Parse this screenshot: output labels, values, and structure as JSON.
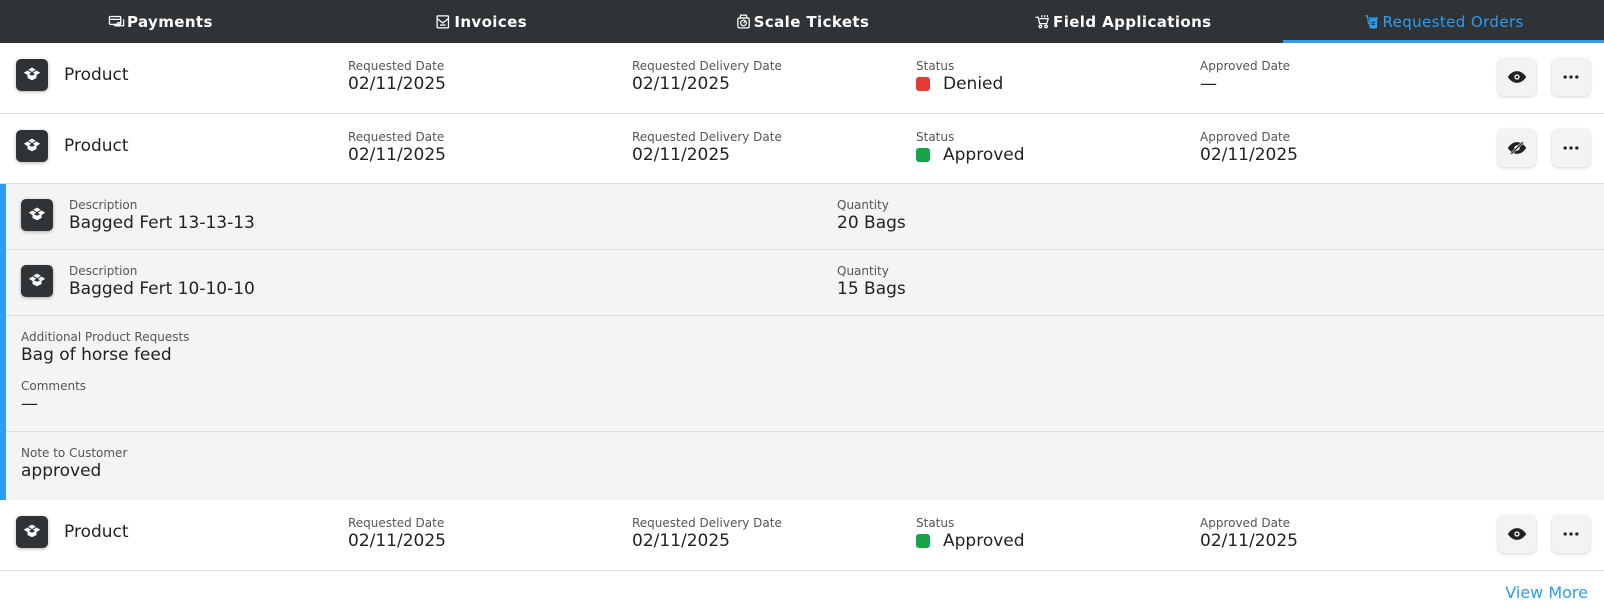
{
  "tabs": [
    {
      "label": "Payments",
      "icon": "payments-icon"
    },
    {
      "label": "Invoices",
      "icon": "invoices-icon"
    },
    {
      "label": "Scale Tickets",
      "icon": "scale-icon"
    },
    {
      "label": "Field Applications",
      "icon": "field-applications-icon"
    },
    {
      "label": "Requested Orders",
      "icon": "requested-orders-icon",
      "active": true
    }
  ],
  "labels": {
    "requested_date": "Requested Date",
    "requested_delivery_date": "Requested Delivery Date",
    "status": "Status",
    "approved_date": "Approved Date",
    "description": "Description",
    "quantity": "Quantity",
    "additional_requests": "Additional Product Requests",
    "comments": "Comments",
    "note_to_customer": "Note to Customer"
  },
  "orders": [
    {
      "type": "Product",
      "requested_date": "02/11/2025",
      "requested_delivery_date": "02/11/2025",
      "status": "Denied",
      "status_color": "#e53935",
      "approved_date": "—",
      "expanded": false
    },
    {
      "type": "Product",
      "requested_date": "02/11/2025",
      "requested_delivery_date": "02/11/2025",
      "status": "Approved",
      "status_color": "#16a34a",
      "approved_date": "02/11/2025",
      "expanded": true,
      "items": [
        {
          "description": "Bagged Fert 13-13-13",
          "quantity": "20 Bags"
        },
        {
          "description": "Bagged Fert 10-10-10",
          "quantity": "15 Bags"
        }
      ],
      "additional_requests": "Bag of horse feed",
      "comments": "—",
      "note_to_customer": "approved"
    },
    {
      "type": "Product",
      "requested_date": "02/11/2025",
      "requested_delivery_date": "02/11/2025",
      "status": "Approved",
      "status_color": "#16a34a",
      "approved_date": "02/11/2025",
      "expanded": false
    }
  ],
  "view_more": "View More",
  "colors": {
    "accent": "#2d9cf2",
    "tabbar": "#2f3336",
    "denied": "#e53935",
    "approved": "#16a34a"
  }
}
